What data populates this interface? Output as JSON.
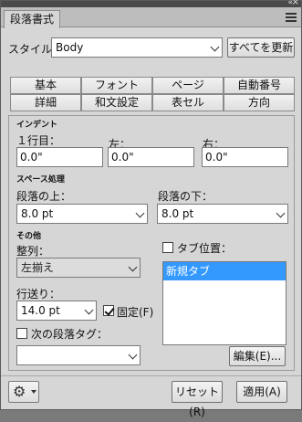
{
  "window": {
    "title": "段落書式"
  },
  "style": {
    "label": "スタイル：",
    "value": "Body",
    "update_button": "すべてを更新"
  },
  "tabs": {
    "row1": [
      "基本",
      "フォント",
      "ページ",
      "自動番号"
    ],
    "row2": [
      "詳細",
      "和文設定",
      "表セル",
      "方向"
    ]
  },
  "indent": {
    "heading": "インデント",
    "first_line_label": "１行目：",
    "first_line_value": "0.0\"",
    "left_label": "左：",
    "left_value": "0.0\"",
    "right_label": "右：",
    "right_value": "0.0\""
  },
  "spacing": {
    "heading": "スペース処理",
    "above_label": "段落の上：",
    "above_value": "8.0 pt",
    "below_label": "段落の下：",
    "below_value": "8.0 pt"
  },
  "other": {
    "heading": "その他",
    "align_label": "整列：",
    "align_value": "左揃え",
    "leading_label": "行送り：",
    "leading_value": "14.0 pt",
    "fixed_label": "固定(F)",
    "fixed_checked": true,
    "next_tag_label": "次の段落タグ：",
    "next_tag_checked": false,
    "next_tag_value": "",
    "tab_stops_label": "タブ位置：",
    "tab_stops_checked": false,
    "tab_stops_items": [
      "新規タブ"
    ],
    "edit_button": "編集(E)..."
  },
  "footer": {
    "reset_button": "リセット(R)",
    "apply_button": "適用(A)"
  },
  "icons": {
    "collapse": "«",
    "close": "×",
    "menu": "menu-icon",
    "gear": "⚙"
  }
}
